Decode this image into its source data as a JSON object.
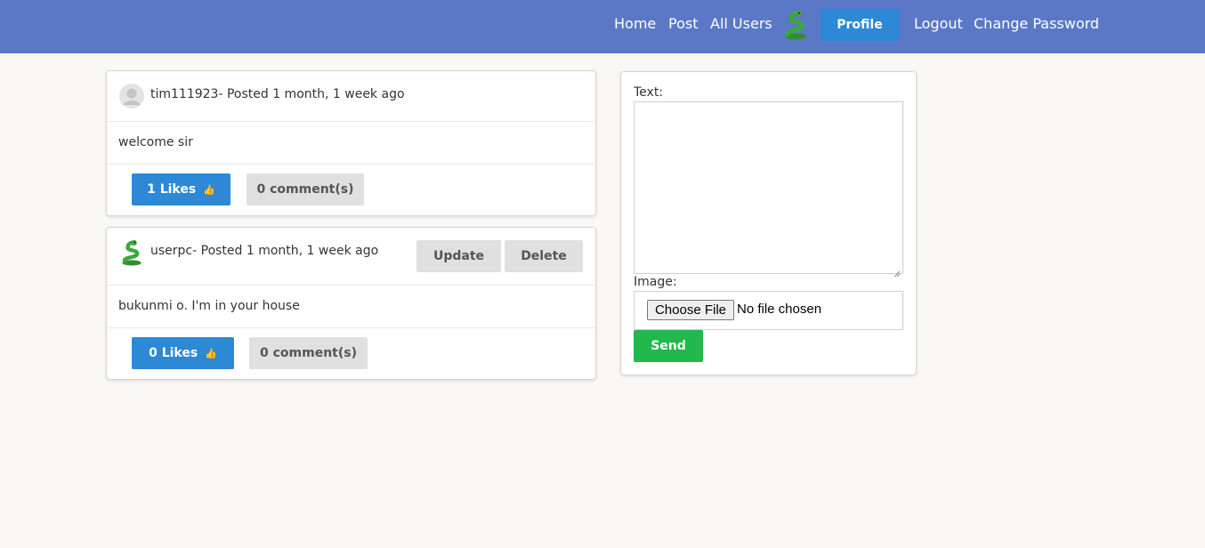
{
  "nav": {
    "home": "Home",
    "post": "Post",
    "all_users": "All Users",
    "avatar_icon": "snake-avatar-icon",
    "profile": "Profile",
    "logout": "Logout",
    "change_password": "Change Password"
  },
  "posts": [
    {
      "meta": "tim111923- Posted 1 month, 1 week ago",
      "avatar_icon": "default-user-icon",
      "text": "welcome sir",
      "likes_label": "1 Likes",
      "comments_label": "0 comment(s)"
    },
    {
      "meta": "userpc- Posted 1 month, 1 week ago",
      "avatar_icon": "snake-avatar-icon",
      "text": "bukunmi o. I'm in your house",
      "update_label": "Update",
      "delete_label": "Delete",
      "likes_label": "0 Likes",
      "comments_label": "0 comment(s)"
    }
  ],
  "form": {
    "text_label": "Text:",
    "text_value": "",
    "image_label": "Image:",
    "choose_file_label": "Choose File",
    "no_file_text": "No file chosen",
    "send_label": "Send"
  },
  "colors": {
    "navbar": "#5b78c7",
    "primary": "#2d88d6",
    "secondary": "#e0e0e0",
    "success": "#22b84b",
    "background": "#f9f8f5"
  }
}
